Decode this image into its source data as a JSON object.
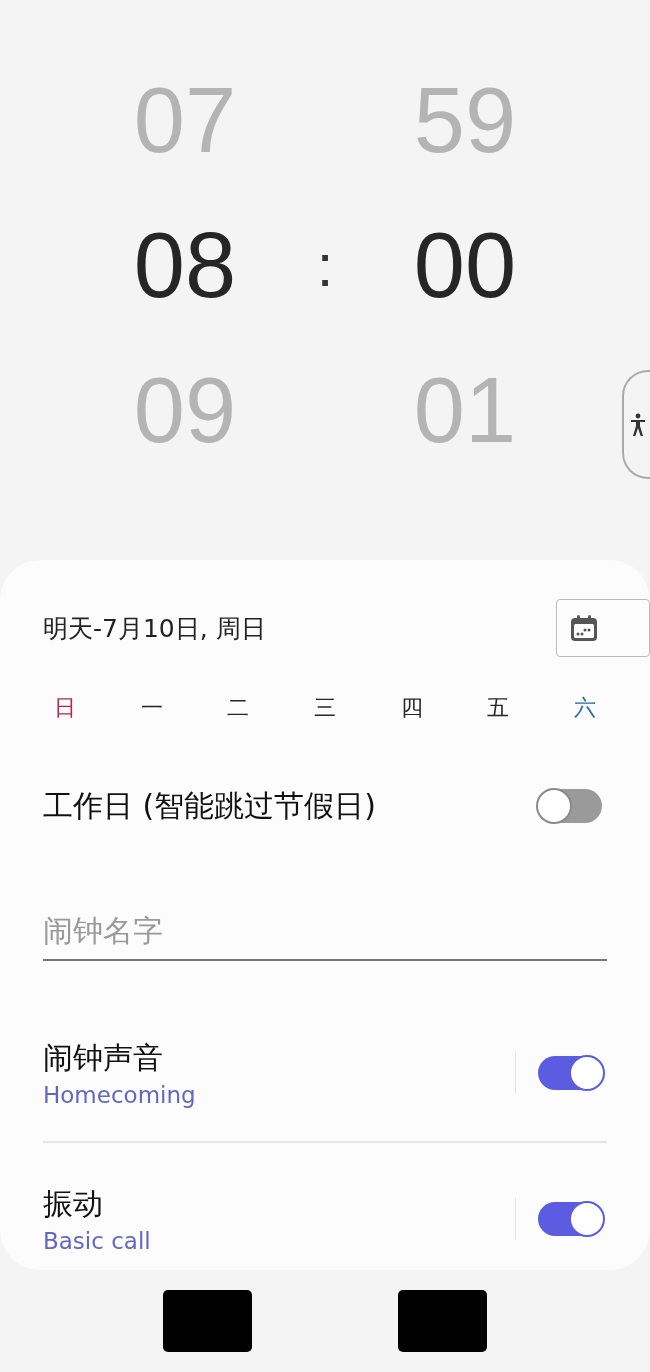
{
  "time_picker": {
    "hour": [
      {
        "value": "07",
        "selected": false
      },
      {
        "value": "08",
        "selected": true
      },
      {
        "value": "09",
        "selected": false
      }
    ],
    "separator": ":",
    "minute": [
      {
        "value": "59",
        "selected": false
      },
      {
        "value": "00",
        "selected": true
      },
      {
        "value": "01",
        "selected": false
      }
    ]
  },
  "date": {
    "text": "明天-7月10日, 周日"
  },
  "weekdays": [
    {
      "label": "日",
      "color": "#b3294e"
    },
    {
      "label": "一",
      "color": "#252525"
    },
    {
      "label": "二",
      "color": "#252525"
    },
    {
      "label": "三",
      "color": "#252525"
    },
    {
      "label": "四",
      "color": "#252525"
    },
    {
      "label": "五",
      "color": "#252525"
    },
    {
      "label": "六",
      "color": "#2a6aa8"
    }
  ],
  "workday": {
    "label": "工作日 (智能跳过节假日)",
    "on": false
  },
  "alarm_name": {
    "placeholder": "闹钟名字"
  },
  "settings": [
    {
      "title": "闹钟声音",
      "value": "Homecoming",
      "on": true
    },
    {
      "title": "振动",
      "value": "Basic call",
      "on": true
    }
  ],
  "bottom_buttons": [
    {
      "kind": "redacted"
    },
    {
      "kind": "redacted"
    }
  ]
}
